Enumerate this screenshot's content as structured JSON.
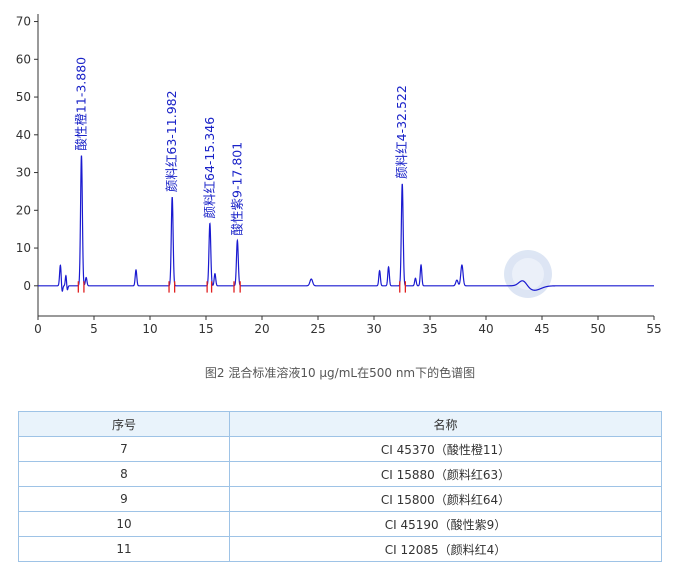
{
  "chart_data": {
    "type": "line",
    "xlim": [
      0,
      55
    ],
    "ylim": [
      -8,
      72
    ],
    "x_ticks": [
      0,
      5,
      10,
      15,
      20,
      25,
      30,
      35,
      40,
      45,
      50,
      55
    ],
    "y_ticks": [
      0,
      10,
      20,
      30,
      40,
      50,
      60,
      70
    ],
    "grid": false,
    "colors": {
      "trace": "#1a1ad0",
      "marker": "#e02020",
      "axis": "#333333"
    },
    "peaks": [
      {
        "rt": 2.0,
        "height": 5.5,
        "width": 0.07
      },
      {
        "rt": 2.5,
        "height": 3.0,
        "width": 0.06
      },
      {
        "rt": 3.88,
        "height": 34.5,
        "width": 0.08
      },
      {
        "rt": 4.3,
        "height": 2.2,
        "width": 0.07
      },
      {
        "rt": 8.75,
        "height": 4.2,
        "width": 0.07
      },
      {
        "rt": 11.982,
        "height": 23.5,
        "width": 0.08
      },
      {
        "rt": 15.346,
        "height": 16.5,
        "width": 0.08
      },
      {
        "rt": 15.8,
        "height": 3.2,
        "width": 0.07
      },
      {
        "rt": 17.801,
        "height": 12.0,
        "width": 0.08
      },
      {
        "rt": 24.4,
        "height": 1.8,
        "width": 0.12
      },
      {
        "rt": 30.5,
        "height": 4.0,
        "width": 0.07
      },
      {
        "rt": 31.3,
        "height": 5.0,
        "width": 0.07
      },
      {
        "rt": 32.522,
        "height": 27.0,
        "width": 0.08
      },
      {
        "rt": 33.7,
        "height": 2.0,
        "width": 0.07
      },
      {
        "rt": 34.2,
        "height": 5.5,
        "width": 0.07
      },
      {
        "rt": 37.4,
        "height": 1.5,
        "width": 0.1
      },
      {
        "rt": 37.85,
        "height": 5.5,
        "width": 0.1
      },
      {
        "rt": 43.3,
        "height": 1.6,
        "width": 0.35
      }
    ],
    "dips": [
      {
        "rt": 2.15,
        "depth": -1.8,
        "width": 0.06
      },
      {
        "rt": 2.6,
        "depth": -1.5,
        "width": 0.06
      },
      {
        "rt": 44.3,
        "depth": -1.2,
        "width": 0.6
      }
    ],
    "peak_labels": [
      {
        "text": "酸性橙11-3.880",
        "rt": 3.88,
        "height": 34.5
      },
      {
        "text": "颜料红63-11.982",
        "rt": 11.982,
        "height": 23.5
      },
      {
        "text": "颜料红64-15.346",
        "rt": 15.346,
        "height": 16.5
      },
      {
        "text": "酸性紫9-17.801",
        "rt": 17.801,
        "height": 12.0
      },
      {
        "text": "颜料红4-32.522",
        "rt": 32.522,
        "height": 27.0
      }
    ],
    "integration_marks": [
      3.6,
      4.1,
      11.7,
      12.2,
      15.1,
      15.5,
      17.5,
      18.05,
      32.3,
      32.8
    ]
  },
  "caption": "图2  混合标准溶液10 μg/mL在500 nm下的色谱图",
  "table": {
    "headers": [
      "序号",
      "名称"
    ],
    "rows": [
      [
        "7",
        "CI 45370（酸性橙11）"
      ],
      [
        "8",
        "CI 15880（颜料红63）"
      ],
      [
        "9",
        "CI 15800（颜料红64）"
      ],
      [
        "10",
        "CI 45190（酸性紫9）"
      ],
      [
        "11",
        "CI 12085（颜料红4）"
      ]
    ]
  }
}
